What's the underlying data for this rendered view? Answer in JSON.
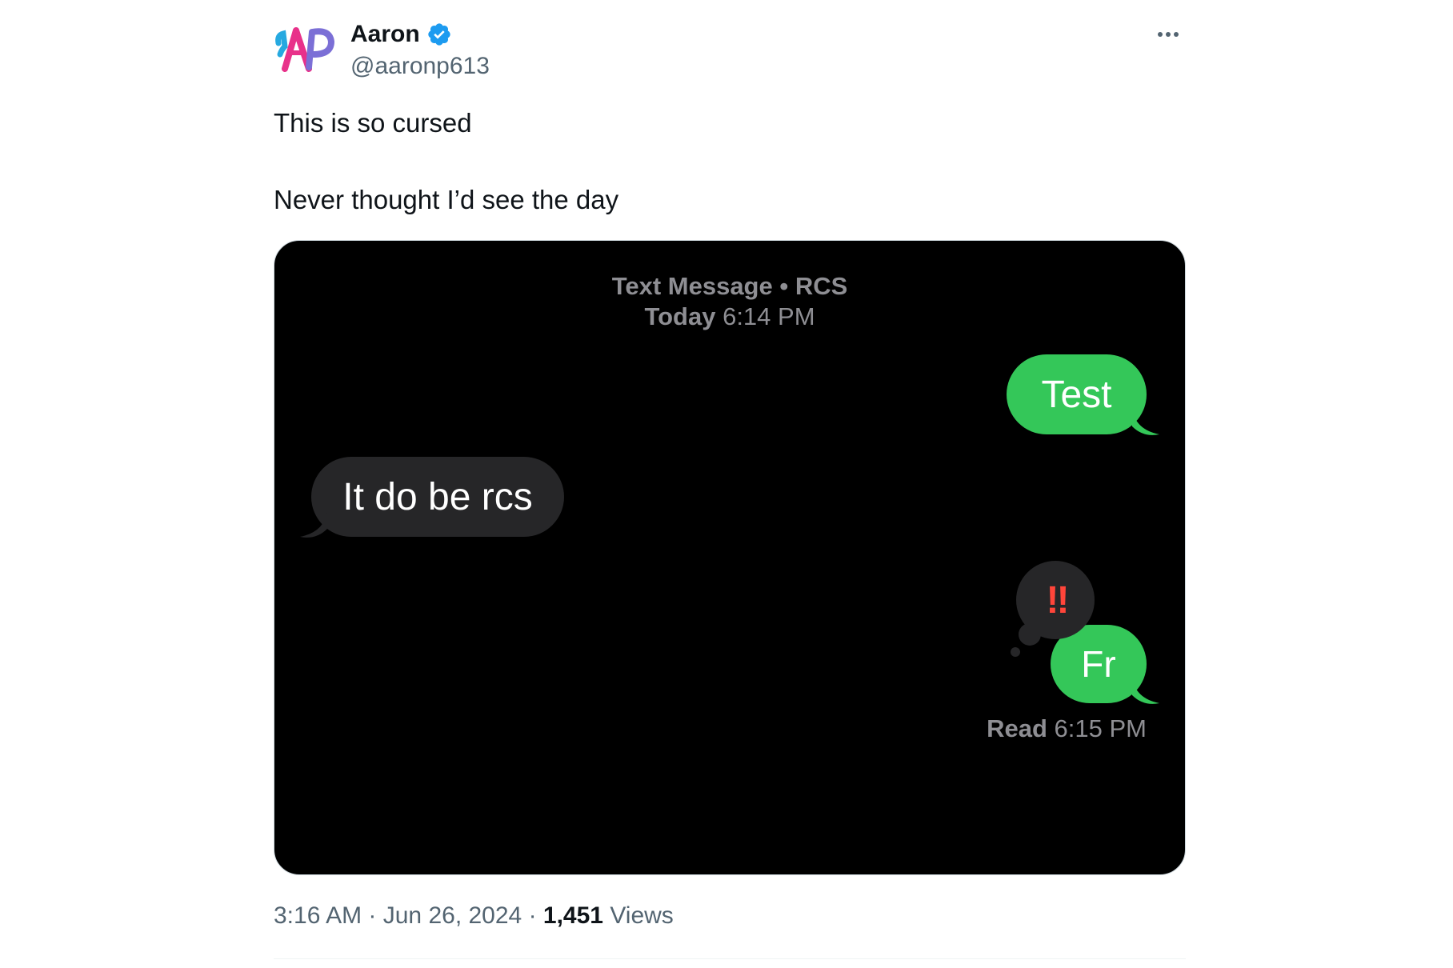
{
  "author": {
    "display_name": "Aaron",
    "handle": "@aaronp613",
    "verified": true,
    "verified_color": "#1d9bf0",
    "avatar_icon": "ap-logo-icon"
  },
  "tweet": {
    "line1": "This is so cursed",
    "line2": "Never thought I’d see the day"
  },
  "media": {
    "header_title": "Text Message • RCS",
    "header_day": "Today",
    "header_time": "6:14 PM",
    "messages": [
      {
        "text": "Test",
        "direction": "sent",
        "color": "#34c759"
      },
      {
        "text": "It do be rcs",
        "direction": "received",
        "color": "#262628"
      },
      {
        "text": "Fr",
        "direction": "sent",
        "color": "#34c759"
      }
    ],
    "tapback": "‼",
    "read_label": "Read",
    "read_time": "6:15 PM"
  },
  "meta": {
    "time": "3:16 AM",
    "separator": " · ",
    "date": "Jun 26, 2024",
    "views_count": "1,451",
    "views_label": "Views"
  }
}
